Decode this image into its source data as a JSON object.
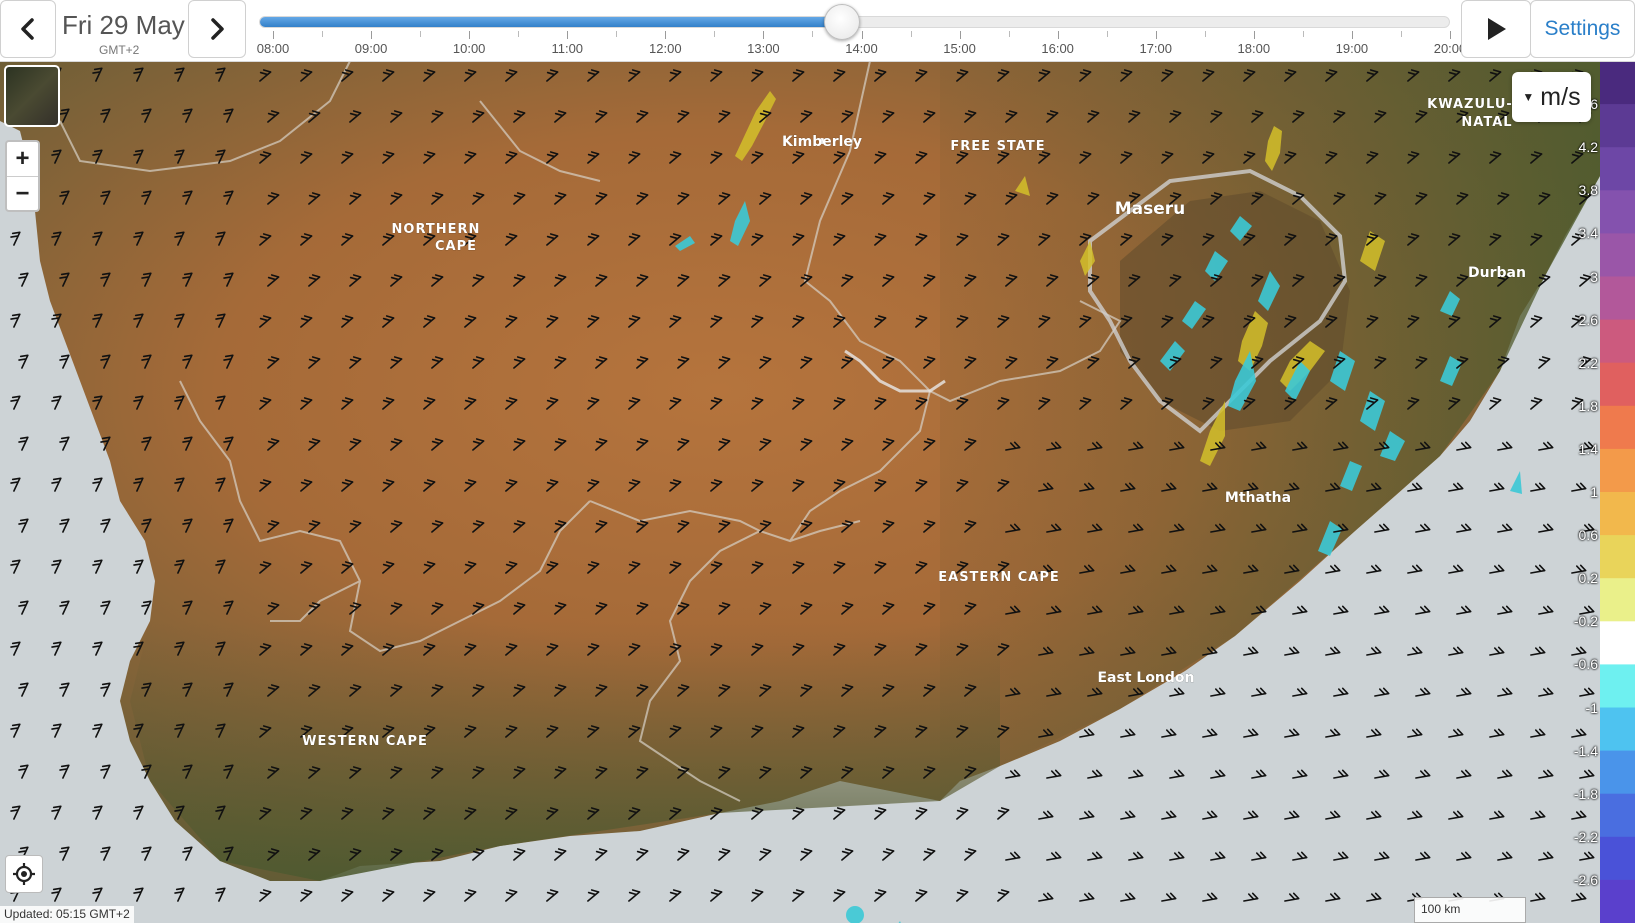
{
  "toolbar": {
    "prev_icon": "chevron-left-icon",
    "next_icon": "chevron-right-icon",
    "date": "Fri 29 May",
    "timezone": "GMT+2",
    "play_icon": "play-icon",
    "settings_label": "Settings"
  },
  "timeline": {
    "hours": [
      "08:00",
      "09:00",
      "10:00",
      "11:00",
      "12:00",
      "13:00",
      "14:00",
      "15:00",
      "16:00",
      "17:00",
      "18:00",
      "19:00",
      "20:00"
    ],
    "position_fraction": 0.4885
  },
  "map": {
    "units_label": "m/s",
    "scale_label": "100 km",
    "updated_label": "Updated: 05:15 GMT+2",
    "zoom_in_label": "+",
    "zoom_out_label": "−",
    "locate_icon": "locate-target-icon",
    "layer_icon": "layer-thumbnail-icon",
    "place_labels": [
      "Kimberley",
      "FREE STATE",
      "Maseru",
      "NORTHERN",
      "CAPE",
      "KWAZULU-",
      "NATAL",
      "Durban",
      "Mthatha",
      "EASTERN CAPE",
      "East London",
      "WESTERN CAPE"
    ]
  },
  "legend": {
    "labels": [
      ">4.6",
      "4.2",
      "3.8",
      "3.4",
      "3",
      "2.6",
      "2.2",
      "1.8",
      "1.4",
      "1",
      "0.6",
      "0.2",
      "-0.2",
      "-0.6",
      "-1",
      "-1.4",
      "-1.8",
      "-2.2",
      "-2.6"
    ],
    "colors": [
      "#4a2a7e",
      "#5c3a94",
      "#6d47a6",
      "#8452ae",
      "#9a56a8",
      "#b2589a",
      "#cc5a7e",
      "#e0605f",
      "#ef7a4d",
      "#f39a4a",
      "#f2b84c",
      "#e9d45a",
      "#eaf08a",
      "#ffffff",
      "#6ef0f0",
      "#4ec3f0",
      "#4a94ea",
      "#4a6ee0",
      "#4a52d8",
      "#5a40cc"
    ]
  }
}
